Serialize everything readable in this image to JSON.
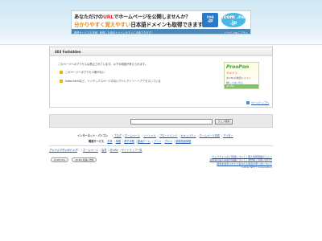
{
  "banner": {
    "line1_a": "あなただけの",
    "line1_b": "URL",
    "line1_c": "でホームページを公開しませんか？",
    "line2_a": "分かりやすく覚えやすい",
    "line2_b": "日本語ドメインも取得できます！",
    "line3": "関連サービスも充実！取得した独自ドメインをすぐに活用できます！",
    "brand": "ドメインbyニフティ",
    "badge_jp_top": "日本語",
    "badge_jp": ".jp",
    "badge_com": ".com .ne .jp"
  },
  "panel": {
    "title": "403 Forbidden",
    "message": "このページへのアクセスは禁止されています。以下の原因が考えられます。",
    "reason1": "このページへのアクセス権がない",
    "reason2": "index.htmlなど、インデックスページのないディレクトリーへアクセスしている",
    "to_top": "ページトップへ"
  },
  "ad_side": {
    "title": "ProoPon",
    "subtitle": "ドメイン",
    "text": "@niftyの独自ドメイン",
    "link": "詳しくはこちら",
    "footer": "@nifty"
  },
  "search": {
    "value": "",
    "button": "ウェブ検索"
  },
  "links_internet": {
    "label": "インターネット・パソコン",
    "items": [
      "ブログ",
      "ホームページ",
      "ソーシャル",
      "ブロードバンド",
      "セキュリティ",
      "ホームページ作成",
      "アバター"
    ]
  },
  "links_services": {
    "label": "関連サービス",
    "items": [
      "天気",
      "地図",
      "電子書籍",
      "動画ゲーム",
      "アニメ",
      "グルメ",
      "健康医療保険"
    ]
  },
  "nifty": {
    "brand": "アットニフティのトップ",
    "items": [
      "ホームページ",
      "会員",
      "@nifty",
      "サイトマップ一覧"
    ]
  },
  "badges": [
    "@nifty Pop",
    "@nifty 会員に登録"
  ],
  "footer": {
    "line1": "ウェブサイトのご利用について | 個人情報保護ポリシー",
    "line2": "利用者の個人情報の保護について | 著作権 | お問い合わせ",
    "line3": "権利を侵害されたと思われる場合の申し出について",
    "copyright": "©2012 NIFTY Corporation"
  }
}
